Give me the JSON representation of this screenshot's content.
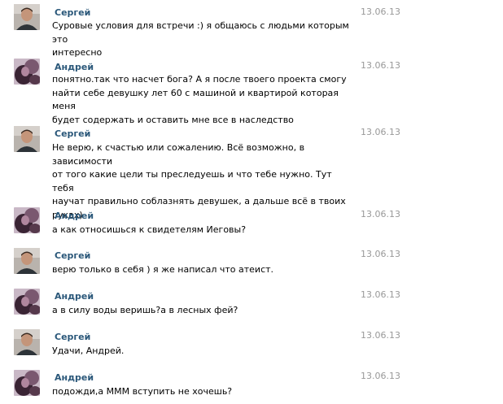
{
  "messages": [
    {
      "author": "Сергей",
      "avatar": "sergey-avatar",
      "date": "13.06.13",
      "text": "Суровые условия для встречи :) я общаюсь с людьми которым это\nинтересно"
    },
    {
      "author": "Андрей",
      "avatar": "andrey-avatar",
      "date": "13.06.13",
      "text": "понятно.так что насчет бога? А я после твоего проекта смогу\nнайти себе девушку лет 60 с машиной и квартирой которая меня\nбудет содержать и оставить мне все в наследство"
    },
    {
      "author": "Сергей",
      "avatar": "sergey-avatar",
      "date": "13.06.13",
      "text": "Не верю, к счастью или сожалению. Всё возможно, в зависимости\nот того какие цели ты преследуешь и что тебе нужно. Тут тебя\nнаучат правильно соблазнять девушек, а дальше всё в твоих\nруках)"
    },
    {
      "author": "Андрей",
      "avatar": "andrey-avatar",
      "date": "13.06.13",
      "text": "а как относишься к свидетелям Иеговы?"
    },
    {
      "author": "Сергей",
      "avatar": "sergey-avatar",
      "date": "13.06.13",
      "text": "верю только в себя ) я же написал что атеист."
    },
    {
      "author": "Андрей",
      "avatar": "andrey-avatar",
      "date": "13.06.13",
      "text": "а в силу воды веришь?а в лесных фей?"
    },
    {
      "author": "Сергей",
      "avatar": "sergey-avatar",
      "date": "13.06.13",
      "text": "Удачи, Андрей."
    },
    {
      "author": "Андрей",
      "avatar": "andrey-avatar",
      "date": "13.06.13",
      "text": "подожди,а МММ вступить не хочешь?"
    }
  ]
}
